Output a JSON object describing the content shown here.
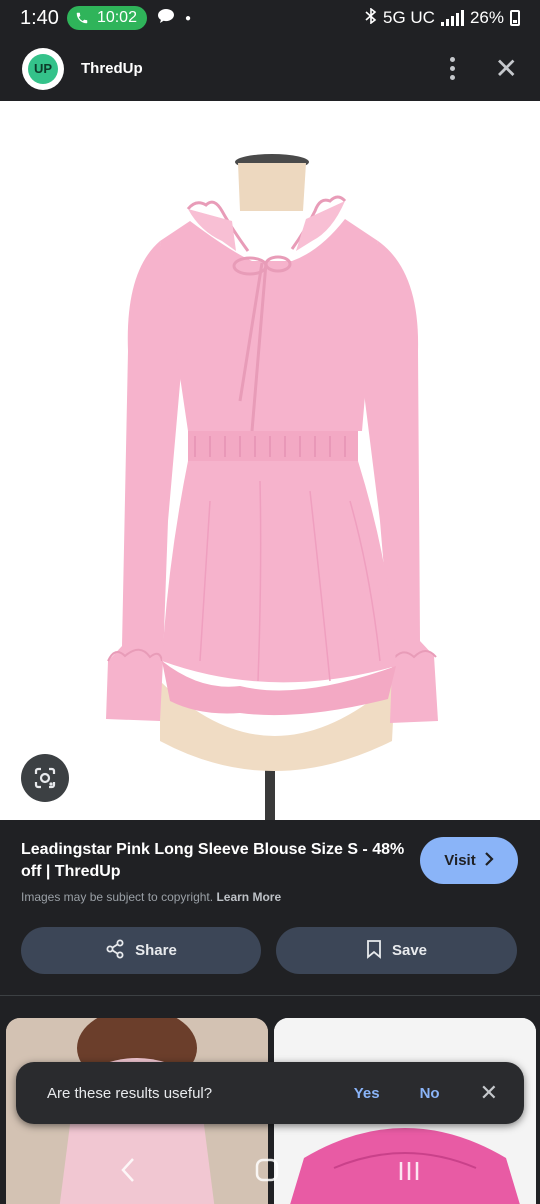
{
  "status_bar": {
    "time": "1:40",
    "call_timer": "10:02",
    "network": "5G UC",
    "battery": "26%"
  },
  "header": {
    "logo_text": "UP",
    "site_name": "ThredUp"
  },
  "product": {
    "title": "Leadingstar Pink Long Sleeve Blouse Size S - 48% off | ThredUp",
    "visit_label": "Visit",
    "copyright_text": "Images may be subject to copyright.",
    "learn_more_label": "Learn More",
    "share_label": "Share",
    "save_label": "Save"
  },
  "feedback": {
    "question": "Are these results useful?",
    "yes_label": "Yes",
    "no_label": "No"
  },
  "colors": {
    "accent": "#8ab4f8",
    "background": "#202124",
    "blouse": "#f6b3cc",
    "call_green": "#2fb45a"
  }
}
